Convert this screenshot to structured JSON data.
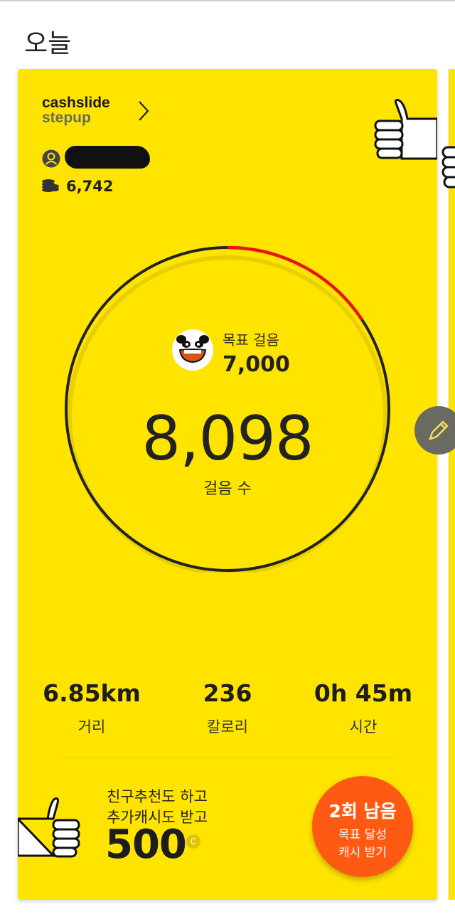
{
  "page": {
    "title": "오늘"
  },
  "brand": {
    "line1": "cashslide",
    "line2": "stepup"
  },
  "user": {
    "coins": "6,742"
  },
  "goal": {
    "label": "목표 걸음",
    "value": "7,000",
    "progress_ratio": 0.157
  },
  "steps": {
    "value": "8,098",
    "label": "걸음 수"
  },
  "stats": [
    {
      "value": "6.85km",
      "label": "거리"
    },
    {
      "value": "236",
      "label": "칼로리"
    },
    {
      "value": "0h 45m",
      "label": "시간"
    }
  ],
  "promo": {
    "line1": "친구추천도 하고",
    "line2": "추가캐시도 받고",
    "amount": "500",
    "cash_symbol": "C"
  },
  "reward_button": {
    "line1": "2회 남음",
    "line2": "목표 달성",
    "line3": "캐시 받기"
  },
  "colors": {
    "card": "#ffe400",
    "ring": "#222222",
    "progress": "#e8150e",
    "reward": "#ff5a13"
  },
  "icons": [
    "user-icon",
    "coins-icon",
    "thumbs-up-icon",
    "panda-icon",
    "pencil-icon",
    "chevron-right-icon"
  ]
}
